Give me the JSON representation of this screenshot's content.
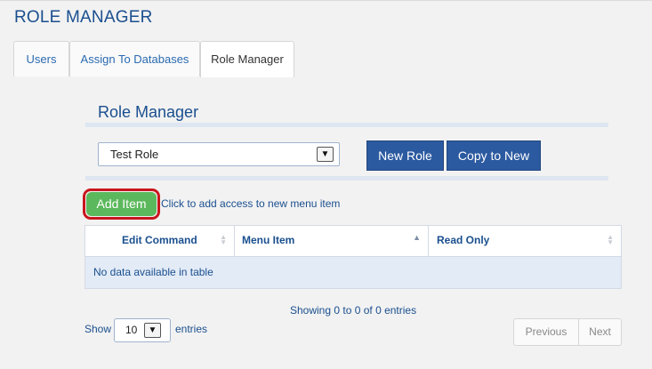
{
  "page": {
    "title": "ROLE MANAGER"
  },
  "tabs": [
    {
      "label": "Users",
      "active": false
    },
    {
      "label": "Assign To Databases",
      "active": false
    },
    {
      "label": "Role Manager",
      "active": true
    }
  ],
  "section": {
    "title": "Role Manager"
  },
  "role_select": {
    "value": "Test Role",
    "caret": "▼"
  },
  "buttons": {
    "new_role": "New Role",
    "copy_to_new": "Copy to New"
  },
  "add_item": {
    "label": "Add Item",
    "hint": "Click to add access to new menu item",
    "highlight_color": "#c8161d"
  },
  "table": {
    "columns": [
      {
        "label": "Edit Command",
        "sort": "both"
      },
      {
        "label": "Menu Item",
        "sort": "asc"
      },
      {
        "label": "Read Only",
        "sort": "both"
      }
    ],
    "empty_message": "No data available in table"
  },
  "info": "Showing 0 to 0 of 0 entries",
  "length": {
    "prefix": "Show",
    "value": "10",
    "suffix": "entries",
    "caret": "▼"
  },
  "pagination": {
    "previous": "Previous",
    "next": "Next"
  },
  "colors": {
    "brand": "#1a4f8f",
    "primary_button": "#2c5aa0",
    "add_button": "#5cb85c",
    "row_highlight": "#e3ebf6"
  }
}
